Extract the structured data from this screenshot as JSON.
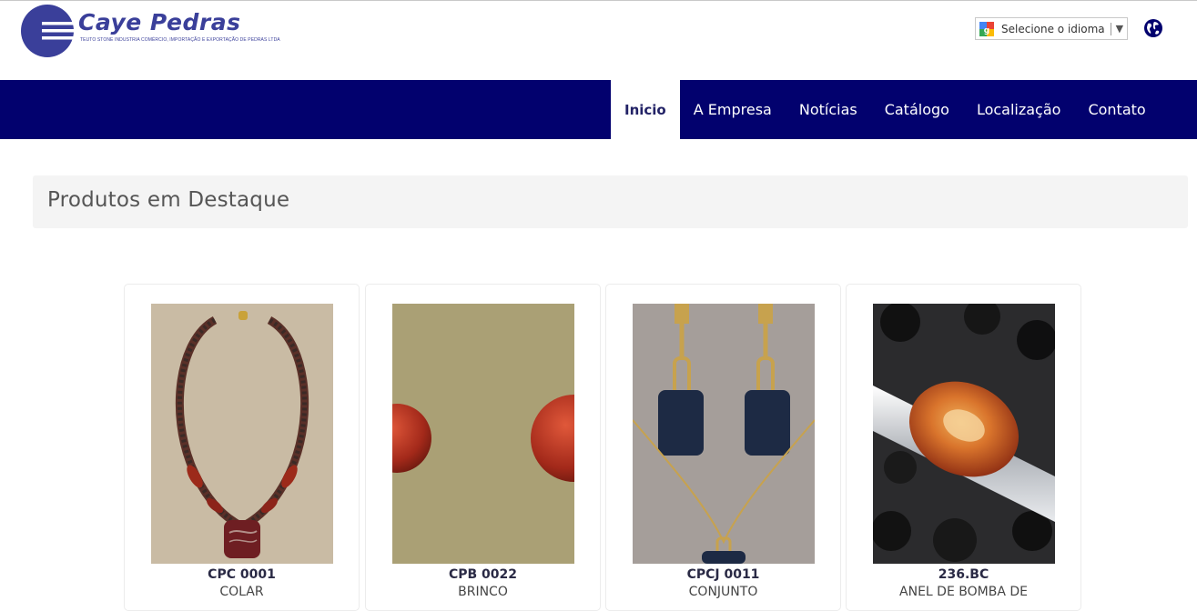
{
  "brand": {
    "name": "Caye Pedras",
    "tagline": "TEUTO STONE INDUSTRIA COMÉRCIO, IMPORTAÇÃO E EXPORTAÇÃO DE PEDRAS LTDA",
    "color": "#3a3f9a"
  },
  "language": {
    "label": "Selecione o idioma",
    "icon": "google-translate-icon"
  },
  "header_icons": {
    "globe": "globe-icon"
  },
  "nav": {
    "color": "#02016e",
    "items": [
      {
        "label": "Inicio",
        "active": true
      },
      {
        "label": "A Empresa"
      },
      {
        "label": "Notícias"
      },
      {
        "label": "Catálogo"
      },
      {
        "label": "Localização"
      },
      {
        "label": "Contato"
      }
    ]
  },
  "featured": {
    "title": "Produtos em Destaque",
    "products": [
      {
        "code": "CPC 0001",
        "name": "COLAR"
      },
      {
        "code": "CPB 0022",
        "name": "BRINCO"
      },
      {
        "code": "CPCJ 0011",
        "name": "CONJUNTO"
      },
      {
        "code": "236.BC",
        "name": "ANEL DE BOMBA DE"
      }
    ]
  }
}
